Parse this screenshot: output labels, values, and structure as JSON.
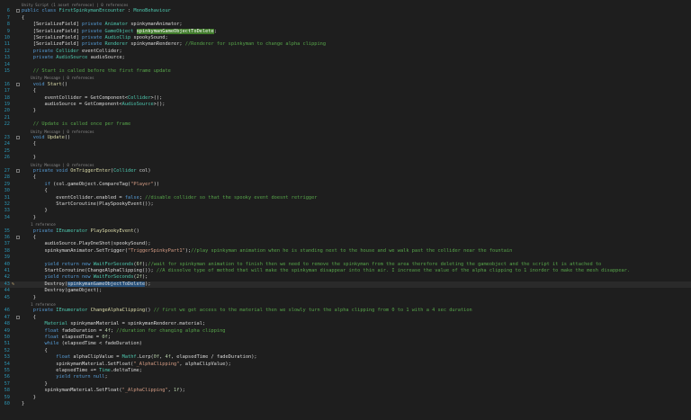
{
  "lines": [
    {
      "n": "",
      "hint": true,
      "segs": [
        [
          "",
          "Unity Script (1 asset reference) | 0 references"
        ]
      ]
    },
    {
      "n": "6",
      "segs": [
        [
          "k",
          "public class "
        ],
        [
          "t",
          "FirstSpinkymanEncounter"
        ],
        [
          "",
          " : "
        ],
        [
          "t",
          "MonoBehaviour"
        ]
      ]
    },
    {
      "n": "7",
      "segs": [
        [
          "",
          "{"
        ]
      ]
    },
    {
      "n": "8",
      "segs": [
        [
          "",
          "    [SerializeField] "
        ],
        [
          "k",
          "private "
        ],
        [
          "t",
          "Animator "
        ],
        [
          "",
          "spinkymanAnimator;"
        ]
      ]
    },
    {
      "n": "9",
      "segs": [
        [
          "",
          "    [SerializeField] "
        ],
        [
          "k",
          "private "
        ],
        [
          "t",
          "GameObject "
        ],
        [
          "hl",
          "spinkymanGameObjectToDelete"
        ],
        [
          "",
          ";"
        ]
      ]
    },
    {
      "n": "10",
      "segs": [
        [
          "",
          "    [SerializeField] "
        ],
        [
          "k",
          "private "
        ],
        [
          "t",
          "AudioClip "
        ],
        [
          "",
          "spookySound;"
        ]
      ]
    },
    {
      "n": "11",
      "segs": [
        [
          "",
          "    [SerializeField] "
        ],
        [
          "k",
          "private "
        ],
        [
          "t",
          "Renderer "
        ],
        [
          "",
          "spinkymanRenderer; "
        ],
        [
          "c",
          "//Renderer for spinkyman to change alpha clipping"
        ]
      ]
    },
    {
      "n": "12",
      "segs": [
        [
          "",
          "    "
        ],
        [
          "k",
          "private "
        ],
        [
          "t",
          "Collider "
        ],
        [
          "",
          "eventCollider;"
        ]
      ]
    },
    {
      "n": "13",
      "segs": [
        [
          "",
          "    "
        ],
        [
          "k",
          "private "
        ],
        [
          "t",
          "AudioSource "
        ],
        [
          "",
          "audioSource;"
        ]
      ]
    },
    {
      "n": "14",
      "segs": [
        [
          "",
          ""
        ]
      ]
    },
    {
      "n": "15",
      "segs": [
        [
          "c",
          "    // Start is called before the first frame update"
        ]
      ]
    },
    {
      "n": "",
      "hint": true,
      "segs": [
        [
          "",
          "    Unity Message | 0 references"
        ]
      ]
    },
    {
      "n": "16",
      "segs": [
        [
          "",
          "    "
        ],
        [
          "k",
          "void "
        ],
        [
          "m",
          "Start"
        ],
        [
          "",
          "()"
        ]
      ]
    },
    {
      "n": "17",
      "segs": [
        [
          "",
          "    {"
        ]
      ]
    },
    {
      "n": "18",
      "segs": [
        [
          "",
          "        eventCollider = GetComponent<"
        ],
        [
          "t",
          "Collider"
        ],
        [
          "",
          ">();"
        ]
      ]
    },
    {
      "n": "19",
      "segs": [
        [
          "",
          "        audioSource = GetComponent<"
        ],
        [
          "t",
          "AudioSource"
        ],
        [
          "",
          ">();"
        ]
      ]
    },
    {
      "n": "20",
      "segs": [
        [
          "",
          "    }"
        ]
      ]
    },
    {
      "n": "21",
      "segs": [
        [
          "",
          ""
        ]
      ]
    },
    {
      "n": "22",
      "segs": [
        [
          "c",
          "    // Update is called once per frame"
        ]
      ]
    },
    {
      "n": "",
      "hint": true,
      "segs": [
        [
          "",
          "    Unity Message | 0 references"
        ]
      ]
    },
    {
      "n": "23",
      "segs": [
        [
          "",
          "    "
        ],
        [
          "k",
          "void "
        ],
        [
          "m",
          "Update"
        ],
        [
          "",
          "()"
        ]
      ]
    },
    {
      "n": "24",
      "segs": [
        [
          "",
          "    {"
        ]
      ]
    },
    {
      "n": "25",
      "segs": [
        [
          "",
          ""
        ]
      ]
    },
    {
      "n": "26",
      "segs": [
        [
          "",
          "    }"
        ]
      ]
    },
    {
      "n": "",
      "hint": true,
      "segs": [
        [
          "",
          "    Unity Message | 0 references"
        ]
      ]
    },
    {
      "n": "27",
      "segs": [
        [
          "",
          "    "
        ],
        [
          "k",
          "private void "
        ],
        [
          "m",
          "OnTriggerEnter"
        ],
        [
          "",
          "("
        ],
        [
          "t",
          "Collider "
        ],
        [
          "",
          "col)"
        ]
      ]
    },
    {
      "n": "28",
      "segs": [
        [
          "",
          "    {"
        ]
      ]
    },
    {
      "n": "29",
      "segs": [
        [
          "",
          "        "
        ],
        [
          "k",
          "if "
        ],
        [
          "",
          "(col.gameObject.CompareTag("
        ],
        [
          "s",
          "\"Player\""
        ],
        [
          "",
          "))"
        ]
      ]
    },
    {
      "n": "30",
      "segs": [
        [
          "",
          "        {"
        ]
      ]
    },
    {
      "n": "31",
      "segs": [
        [
          "",
          "            eventCollider.enabled = "
        ],
        [
          "k",
          "false"
        ],
        [
          "",
          "; "
        ],
        [
          "c",
          "//disable collider so that the spooky event doesnt retrigger"
        ]
      ]
    },
    {
      "n": "32",
      "segs": [
        [
          "",
          "            StartCoroutine(PlaySpookyEvent());"
        ]
      ]
    },
    {
      "n": "33",
      "segs": [
        [
          "",
          "        }"
        ]
      ]
    },
    {
      "n": "34",
      "segs": [
        [
          "",
          "    }"
        ]
      ]
    },
    {
      "n": "",
      "hint": true,
      "segs": [
        [
          "",
          "    1 reference"
        ]
      ]
    },
    {
      "n": "35",
      "segs": [
        [
          "",
          "    "
        ],
        [
          "k",
          "private "
        ],
        [
          "t",
          "IEnumerator "
        ],
        [
          "m",
          "PlaySpookyEvent"
        ],
        [
          "",
          "()"
        ]
      ]
    },
    {
      "n": "36",
      "segs": [
        [
          "",
          "    {"
        ]
      ]
    },
    {
      "n": "37",
      "segs": [
        [
          "",
          "        audioSource.PlayOneShot(spookySound);"
        ]
      ]
    },
    {
      "n": "38",
      "segs": [
        [
          "",
          "        spinkymanAnimator.SetTrigger("
        ],
        [
          "s",
          "\"TriggerSpinkyPart1\""
        ],
        [
          "",
          ");"
        ],
        [
          "c",
          "//play spinkyman animation when he is standing next to the house and we walk past the collider near the fountain"
        ]
      ]
    },
    {
      "n": "39",
      "segs": [
        [
          "",
          ""
        ]
      ]
    },
    {
      "n": "40",
      "segs": [
        [
          "",
          "        "
        ],
        [
          "k",
          "yield return new "
        ],
        [
          "t",
          "WaitForSeconds"
        ],
        [
          "",
          "("
        ],
        [
          "n",
          "6f"
        ],
        [
          "",
          ");"
        ],
        [
          "c",
          "//wait for spinkyman animation to finish then we need to remove the spinkyman from the area therefore deleting the gameobject and the script it is attached to"
        ]
      ]
    },
    {
      "n": "41",
      "segs": [
        [
          "",
          "        StartCoroutine(ChangeAlphaClipping()); "
        ],
        [
          "c",
          "//A dissolve type of method that will make the spinkyman disappear into thin air. I increase the value of the alpha clipping to 1 inorder to make the mesh disappear."
        ]
      ]
    },
    {
      "n": "42",
      "segs": [
        [
          "",
          "        "
        ],
        [
          "k",
          "yield return new "
        ],
        [
          "t",
          "WaitForSeconds"
        ],
        [
          "",
          "("
        ],
        [
          "n",
          "2f"
        ],
        [
          "",
          ");"
        ]
      ]
    },
    {
      "n": "43",
      "cur": true,
      "pencil": true,
      "segs": [
        [
          "",
          "        Destroy("
        ],
        [
          "hl2",
          "spinkymanGameObjectToDelete"
        ],
        [
          "",
          ");"
        ]
      ]
    },
    {
      "n": "44",
      "segs": [
        [
          "",
          "        Destroy(gameObject);"
        ]
      ]
    },
    {
      "n": "45",
      "segs": [
        [
          "",
          "    }"
        ]
      ]
    },
    {
      "n": "",
      "hint": true,
      "segs": [
        [
          "",
          "    1 reference"
        ]
      ]
    },
    {
      "n": "46",
      "segs": [
        [
          "",
          "    "
        ],
        [
          "k",
          "private "
        ],
        [
          "t",
          "IEnumerator "
        ],
        [
          "m",
          "ChangeAlphaClipping"
        ],
        [
          "",
          "() "
        ],
        [
          "c",
          "// first we get access to the material then we slowly turn the alpha clipping from 0 to 1 with a 4 sec duration"
        ]
      ]
    },
    {
      "n": "47",
      "segs": [
        [
          "",
          "    {"
        ]
      ]
    },
    {
      "n": "48",
      "segs": [
        [
          "",
          "        "
        ],
        [
          "t",
          "Material "
        ],
        [
          "",
          "spinkymanMaterial = spinkymanRenderer.material;"
        ]
      ]
    },
    {
      "n": "49",
      "segs": [
        [
          "",
          "        "
        ],
        [
          "k",
          "float "
        ],
        [
          "",
          "fadeDuration = "
        ],
        [
          "n",
          "4f"
        ],
        [
          "",
          "; "
        ],
        [
          "c",
          "//duration for changing alpha clipping"
        ]
      ]
    },
    {
      "n": "50",
      "segs": [
        [
          "",
          "        "
        ],
        [
          "k",
          "float "
        ],
        [
          "",
          "elapsedTime = "
        ],
        [
          "n",
          "0f"
        ],
        [
          "",
          ";"
        ]
      ]
    },
    {
      "n": "51",
      "segs": [
        [
          "",
          "        "
        ],
        [
          "k",
          "while "
        ],
        [
          "",
          "(elapsedTime < fadeDuration)"
        ]
      ]
    },
    {
      "n": "52",
      "segs": [
        [
          "",
          "        {"
        ]
      ]
    },
    {
      "n": "53",
      "segs": [
        [
          "",
          "            "
        ],
        [
          "k",
          "float "
        ],
        [
          "",
          "alphaClipValue = "
        ],
        [
          "t",
          "Mathf"
        ],
        [
          "",
          ".Lerp("
        ],
        [
          "n",
          "0f"
        ],
        [
          "",
          ", "
        ],
        [
          "n",
          "4f"
        ],
        [
          "",
          ", elapsedTime / fadeDuration);"
        ]
      ]
    },
    {
      "n": "54",
      "segs": [
        [
          "",
          "            spinkymanMaterial.SetFloat("
        ],
        [
          "s",
          "\"_AlphaClipping\""
        ],
        [
          "",
          ", alphaClipValue);"
        ]
      ]
    },
    {
      "n": "55",
      "segs": [
        [
          "",
          "            elapsedTime += "
        ],
        [
          "t",
          "Time"
        ],
        [
          "",
          ".deltaTime;"
        ]
      ]
    },
    {
      "n": "56",
      "segs": [
        [
          "",
          "            "
        ],
        [
          "k",
          "yield return null"
        ],
        [
          "",
          ";"
        ]
      ]
    },
    {
      "n": "57",
      "segs": [
        [
          "",
          "        }"
        ]
      ]
    },
    {
      "n": "58",
      "segs": [
        [
          "",
          "        spinkymanMaterial.SetFloat("
        ],
        [
          "s",
          "\"_AlphaClipping\""
        ],
        [
          "",
          ", "
        ],
        [
          "n",
          "1f"
        ],
        [
          "",
          ");"
        ]
      ]
    },
    {
      "n": "59",
      "segs": [
        [
          "",
          "    }"
        ]
      ]
    },
    {
      "n": "60",
      "segs": [
        [
          "",
          "}"
        ]
      ]
    }
  ],
  "colors": {
    "background": "#1e1e1e",
    "keyword": "#569cd6",
    "type": "#4ec9b0",
    "method": "#dcdcaa",
    "string": "#d69d85",
    "comment": "#57a64a",
    "number": "#b5cea8",
    "line_number": "#2b91af",
    "highlight": "#3f7a2a"
  },
  "icons": {
    "fold": "fold-toggle-icon",
    "edit_marker": "pencil-icon"
  }
}
